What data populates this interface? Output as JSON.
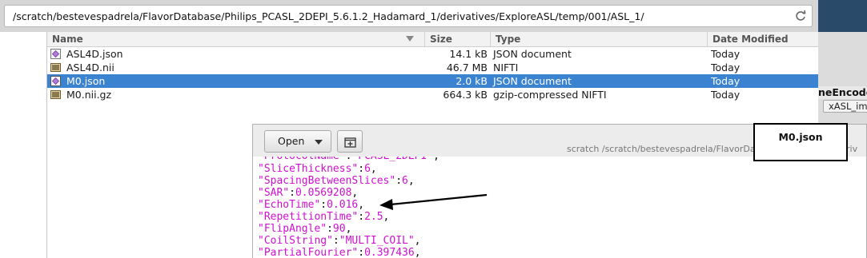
{
  "location": {
    "path": "/scratch/bestevespadrela/FlavorDatabase/Philips_PCASL_2DEPI_5.6.1.2_Hadamard_1/derivatives/ExploreASL/temp/001/ASL_1/"
  },
  "columns": {
    "name": "Name",
    "size": "Size",
    "type": "Type",
    "date": "Date Modified"
  },
  "files": [
    {
      "name": "ASL4D.json",
      "size": "14.1 kB",
      "type": "JSON document",
      "date": "Today",
      "icon": "json-file-icon",
      "selected": false
    },
    {
      "name": "ASL4D.nii",
      "size": "46.7 MB",
      "type": "NIFTI",
      "date": "Today",
      "icon": "image-file-icon",
      "selected": false
    },
    {
      "name": "M0.json",
      "size": "2.0 kB",
      "type": "JSON document",
      "date": "Today",
      "icon": "json-file-icon",
      "selected": true
    },
    {
      "name": "M0.nii.gz",
      "size": "664.3 kB",
      "type": "gzip-compressed NIFTI",
      "date": "Today",
      "icon": "image-file-icon",
      "selected": false
    }
  ],
  "right_panel": {
    "label": "neEncode",
    "tab": "xASL_im"
  },
  "preview": {
    "open_label": "Open",
    "filename": "M0.json",
    "path": "scratch /scratch/bestevespadrela/FlavorDatabas...damard_1/deriv",
    "lines": [
      {
        "key": "\"SliceThickness\"",
        "value": "6"
      },
      {
        "key": "\"SpacingBetweenSlices\"",
        "value": "6"
      },
      {
        "key": "\"SAR\"",
        "value": "0.0569208"
      },
      {
        "key": "\"EchoTime\"",
        "value": "0.016"
      },
      {
        "key": "\"RepetitionTime\"",
        "value": "2.5"
      },
      {
        "key": "\"FlipAngle\"",
        "value": "90"
      },
      {
        "key": "\"CoilString\"",
        "value": "\"MULTI_COIL\""
      },
      {
        "key": "\"PartialFourier\"",
        "value": "0.397436"
      }
    ]
  },
  "colors": {
    "selection": "#3b83d0",
    "json_key": "#d010d0",
    "window_accent": "#2a4a69"
  }
}
